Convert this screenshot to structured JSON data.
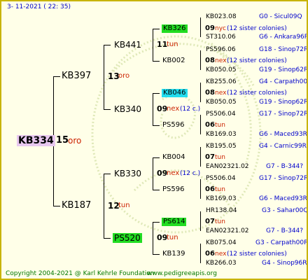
{
  "header": {
    "date_text": "3- 11-2021 ( 22: 35)"
  },
  "root": {
    "code": "KB334",
    "number": "15",
    "suffix": "oro"
  },
  "gen1": [
    {
      "code": "KB397",
      "number": "13",
      "suffix": "oro"
    },
    {
      "code": "KB187",
      "number": "12",
      "suffix": "tun"
    }
  ],
  "gen2": [
    {
      "code": "KB441",
      "number": "11",
      "suffix": "tun"
    },
    {
      "code": "KB340",
      "number": "09",
      "suffix": "nex",
      "extra": "(12 c.)"
    },
    {
      "code": "KB330",
      "number": "09",
      "suffix": "nex",
      "extra": "(12 c.)"
    },
    {
      "code": "PS520",
      "number": "09",
      "suffix": "tun"
    }
  ],
  "gen3": [
    {
      "code": "KB326",
      "number": "09",
      "suffix": "nyc",
      "extra": "(12 sister colonies)"
    },
    {
      "code": "KB002",
      "number": "08",
      "suffix": "nex",
      "extra": "(12 sister colonies)"
    },
    {
      "code": "KB046",
      "number": "08",
      "suffix": "nex",
      "extra": "(12 sister colonies)"
    },
    {
      "code": "PS596",
      "number": "06",
      "suffix": "tun"
    },
    {
      "code": "KB004",
      "number": "07",
      "suffix": "tun"
    },
    {
      "code": "PS596",
      "number": "06",
      "suffix": "tun"
    },
    {
      "code": "PS614",
      "number": "07",
      "suffix": "tun"
    },
    {
      "code": "KB139",
      "number": "06",
      "suffix": "nex",
      "extra": "(12 sister colonies)"
    }
  ],
  "gen4": [
    {
      "code": "KB023.08",
      "region": "G0 - Sicul09Q"
    },
    {
      "code": "ST310.06",
      "region": "G6 - Ankara96R"
    },
    {
      "code": "PS596.06",
      "region": "G18 - Sinop72R"
    },
    {
      "code": "KB050.05",
      "region": "G19 - Sinop62R"
    },
    {
      "code": "KB255.06",
      "region": "G4 - Carpath00R"
    },
    {
      "code": "KB050.05",
      "region": "G19 - Sinop62R"
    },
    {
      "code": "PS506.04",
      "region": "G17 - Sinop72R"
    },
    {
      "code": "KB169.03",
      "region": "G6 - Maced93R"
    },
    {
      "code": "KB195.05",
      "region": "G4 - Carnic99R"
    },
    {
      "code": "EAN02321.02",
      "region": "G7 - B-344?"
    },
    {
      "code": "PS506.04",
      "region": "G17 - Sinop72R"
    },
    {
      "code": "KB169.03",
      "region": "G6 - Maced93R"
    },
    {
      "code": "HR138.04",
      "region": "G3 - Sahar00Q"
    },
    {
      "code": "EAN02321.02",
      "region": "G7 - B-344?"
    },
    {
      "code": "KB075.04",
      "region": "G3 - Carpath00R"
    },
    {
      "code": "KB266.03",
      "region": "G4 - Sinop96R"
    }
  ],
  "footer": {
    "copyright": "Copyright 2004-2021 @ Karl Kehrle Foundation",
    "site": "www.pedigreeapis.org"
  },
  "colors": {
    "highlight_green": "#22dd22",
    "highlight_cyan": "#22ddee",
    "root_highlight": "#e8c8f0"
  }
}
